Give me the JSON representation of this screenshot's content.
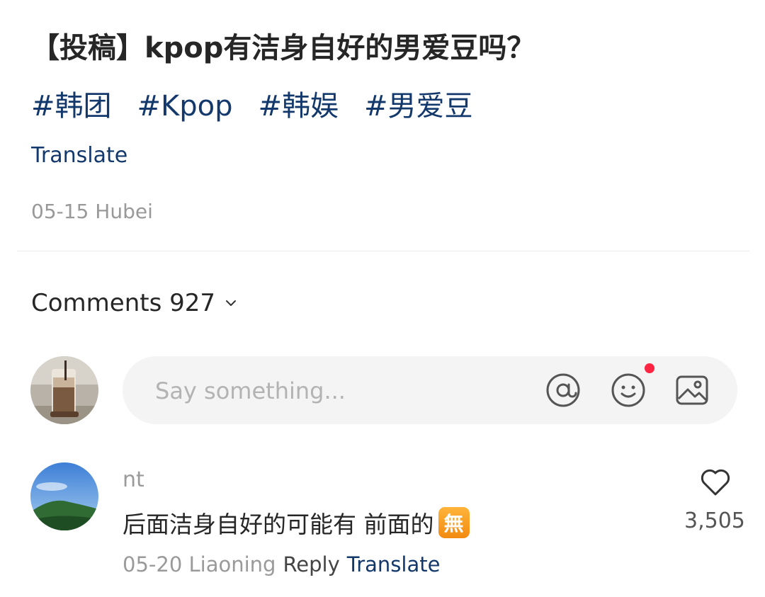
{
  "post": {
    "title": "【投稿】kpop有洁身自好的男爱豆吗？",
    "tags": [
      "#韩团",
      "#Kpop",
      "#韩娱",
      "#男爱豆"
    ],
    "translate_label": "Translate",
    "meta": "05-15 Hubei"
  },
  "comments_header": {
    "label": "Comments 927"
  },
  "comment_input": {
    "placeholder": "Say something...",
    "icons": [
      "at-icon",
      "emoji-icon",
      "image-icon"
    ]
  },
  "comments": [
    {
      "user": "nt",
      "text": "后面洁身自好的可能有 前面的",
      "emoji": "無",
      "date_location": "05-20 Liaoning",
      "reply_label": "Reply",
      "translate_label": "Translate",
      "likes": "3,505"
    }
  ],
  "colors": {
    "link": "#13386c",
    "notification_dot": "#ff2442",
    "muted": "#999999"
  }
}
